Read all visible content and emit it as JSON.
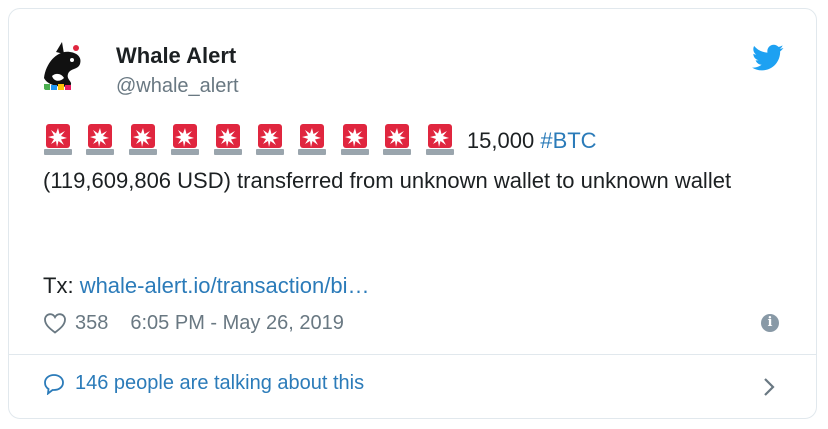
{
  "tweet": {
    "author_name": "Whale Alert",
    "author_handle": "@whale_alert",
    "amount": "15,000",
    "hashtag": "#BTC",
    "body_line": "(119,609,806 USD) transferred from unknown wallet to unknown wallet",
    "tx_prefix": "Tx:",
    "tx_link": "whale-alert.io/transaction/bi…",
    "likes": "358",
    "timestamp": "6:05 PM - May 26, 2019",
    "siren_count": 10
  },
  "footer": {
    "talking": "146 people are talking about this"
  },
  "colors": {
    "link": "#2b7bb9",
    "muted": "#697882",
    "twitter_blue": "#1da1f2",
    "siren_red": "#e0263f"
  },
  "icons": [
    "whale-avatar",
    "twitter-bird-icon",
    "siren-icon",
    "heart-icon",
    "info-icon",
    "comment-bubble-icon",
    "chevron-right-icon"
  ]
}
